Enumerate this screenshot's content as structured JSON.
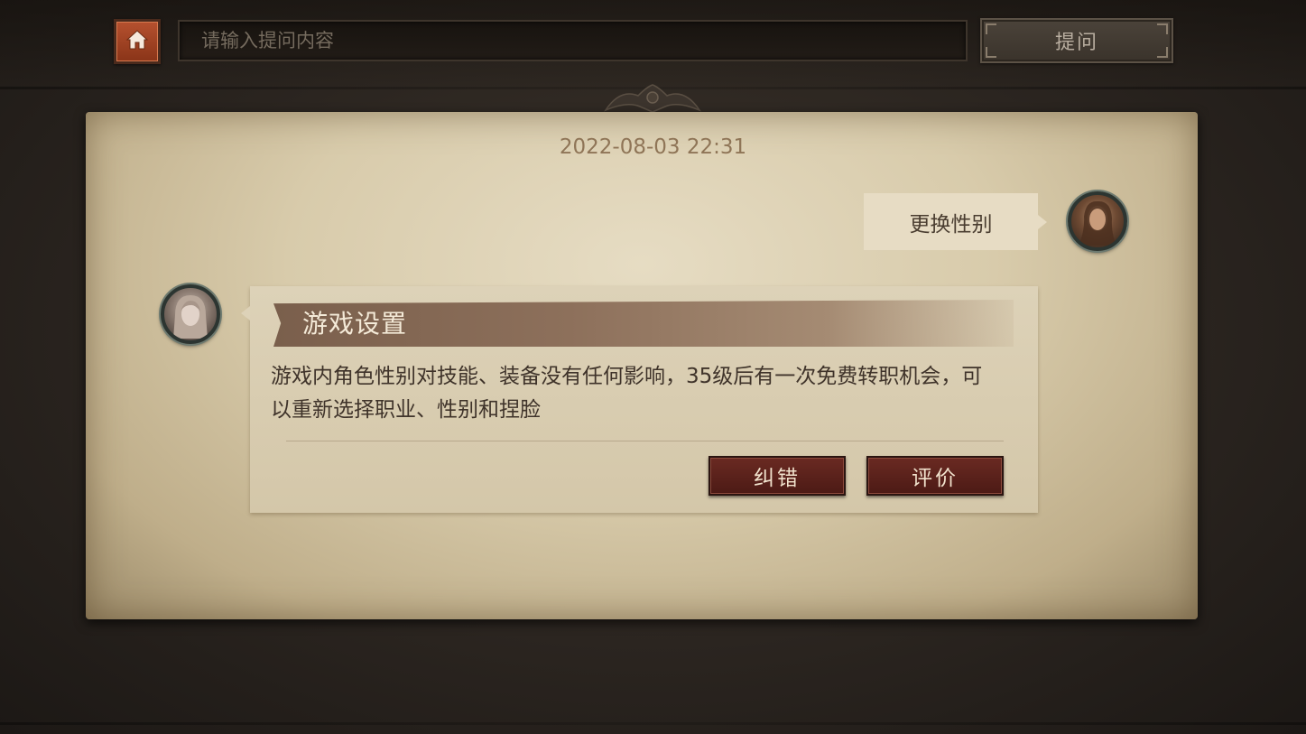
{
  "topbar": {
    "search_placeholder": "请输入提问内容",
    "ask_label": "提问"
  },
  "chat": {
    "timestamp": "2022-08-03 22:31",
    "user_message": "更换性别",
    "answer": {
      "title": "游戏设置",
      "body": "游戏内角色性别对技能、装备没有任何影响，35级后有一次免费转职机会，可以重新选择职业、性别和捏脸",
      "correct_label": "纠错",
      "rate_label": "评价"
    }
  },
  "icons": {
    "home": "home-icon",
    "user_avatar": "user-avatar",
    "assistant_avatar": "assistant-avatar"
  },
  "colors": {
    "accent_home": "#b5512f",
    "button_dark_red": "#5b221b",
    "parchment": "#d8cbab"
  }
}
